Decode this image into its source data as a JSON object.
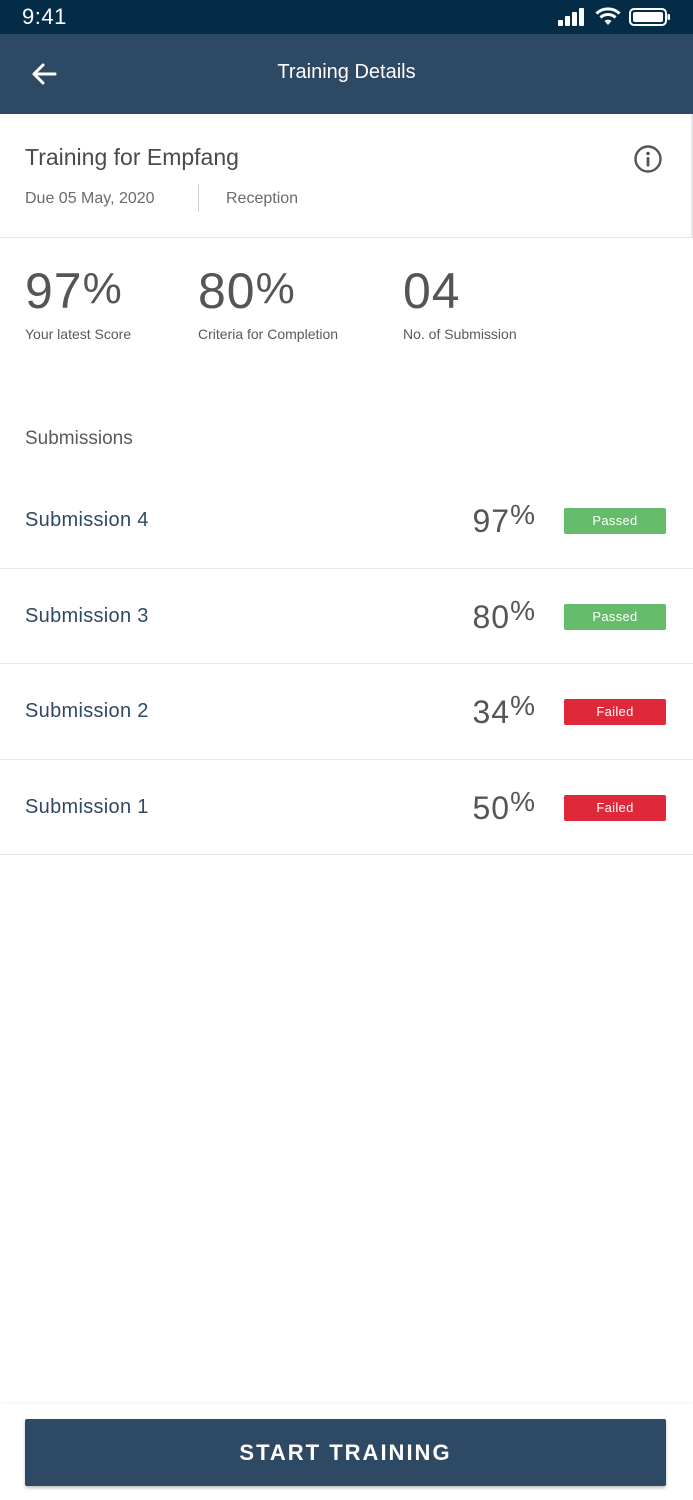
{
  "status_bar": {
    "time": "9:41"
  },
  "header": {
    "title": "Training Details",
    "back_icon": "arrow-left-icon"
  },
  "training": {
    "title": "Training for Empfang",
    "due": "Due 05 May, 2020",
    "department": "Reception",
    "info_icon": "info-icon"
  },
  "stats": [
    {
      "value": "97",
      "unit": "%",
      "label": "Your latest Score"
    },
    {
      "value": "80",
      "unit": "%",
      "label": "Criteria for Completion"
    },
    {
      "value": "04",
      "unit": "",
      "label": "No. of Submission"
    }
  ],
  "submissions": {
    "heading": "Submissions",
    "items": [
      {
        "name": "Submission 4",
        "score": "97",
        "unit": "%",
        "status": "Passed"
      },
      {
        "name": "Submission 3",
        "score": "80",
        "unit": "%",
        "status": "Passed"
      },
      {
        "name": "Submission 2",
        "score": "34",
        "unit": "%",
        "status": "Failed"
      },
      {
        "name": "Submission 1",
        "score": "50",
        "unit": "%",
        "status": "Failed"
      }
    ]
  },
  "actions": {
    "start_label": "START TRAINING"
  },
  "colors": {
    "status_bar": "#042c47",
    "primary": "#2e4964",
    "passed": "#65bc6a",
    "failed": "#e0283b"
  }
}
